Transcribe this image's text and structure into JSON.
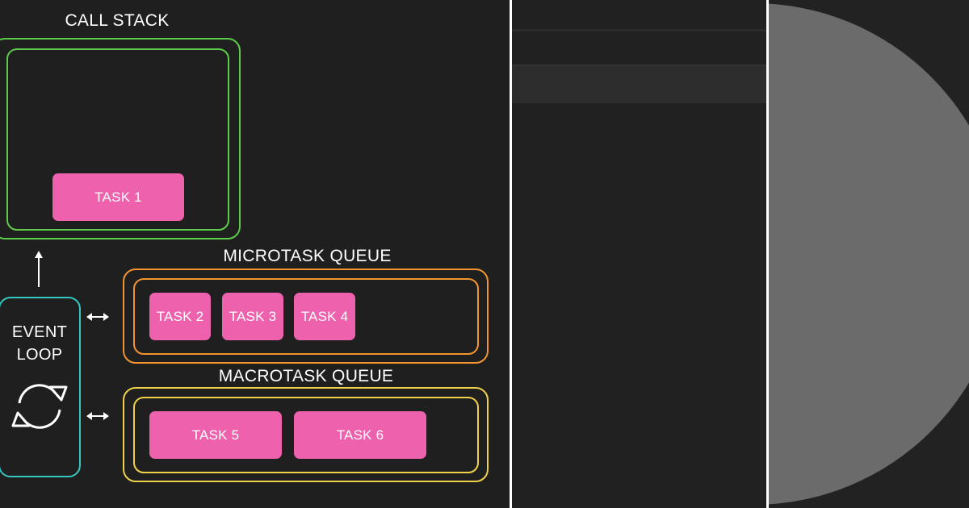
{
  "diagram": {
    "call_stack": {
      "title": "CALL STACK",
      "tasks": [
        "TASK 1"
      ]
    },
    "event_loop": {
      "line1": "EVENT",
      "line2": "LOOP"
    },
    "microtask_queue": {
      "title": "MICROTASK QUEUE",
      "tasks": [
        "TASK 2",
        "TASK 3",
        "TASK 4"
      ]
    },
    "macrotask_queue": {
      "title": "MACROTASK QUEUE",
      "tasks": [
        "TASK 5",
        "TASK 6"
      ]
    }
  },
  "colors": {
    "call_stack_border": "#5ecb4a",
    "microtask_border": "#f29430",
    "macrotask_border": "#f0d24a",
    "event_loop_border": "#34c7c2",
    "task_fill": "#ee62ad",
    "panel_background": "#1f1f1f"
  },
  "icons": {
    "event_loop": "circular-arrows-icon",
    "up_arrow": "arrow-up-icon",
    "bidirectional": "double-arrow-icon"
  }
}
